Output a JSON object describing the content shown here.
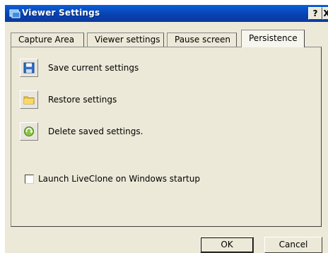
{
  "window": {
    "title": "Viewer Settings",
    "help_label": "?",
    "close_label": "X"
  },
  "tabs": [
    {
      "label": "Capture Area",
      "active": false
    },
    {
      "label": "Viewer settings",
      "active": false
    },
    {
      "label": "Pause screen",
      "active": false
    },
    {
      "label": "Persistence",
      "active": true
    }
  ],
  "actions": [
    {
      "label": "Save current settings",
      "icon": "floppy-disk-icon"
    },
    {
      "label": "Restore settings",
      "icon": "folder-icon"
    },
    {
      "label": "Delete saved settings.",
      "icon": "recycle-icon"
    }
  ],
  "startup_checkbox": {
    "label": "Launch LiveClone on  Windows startup",
    "checked": false
  },
  "buttons": {
    "ok": "OK",
    "cancel": "Cancel"
  }
}
